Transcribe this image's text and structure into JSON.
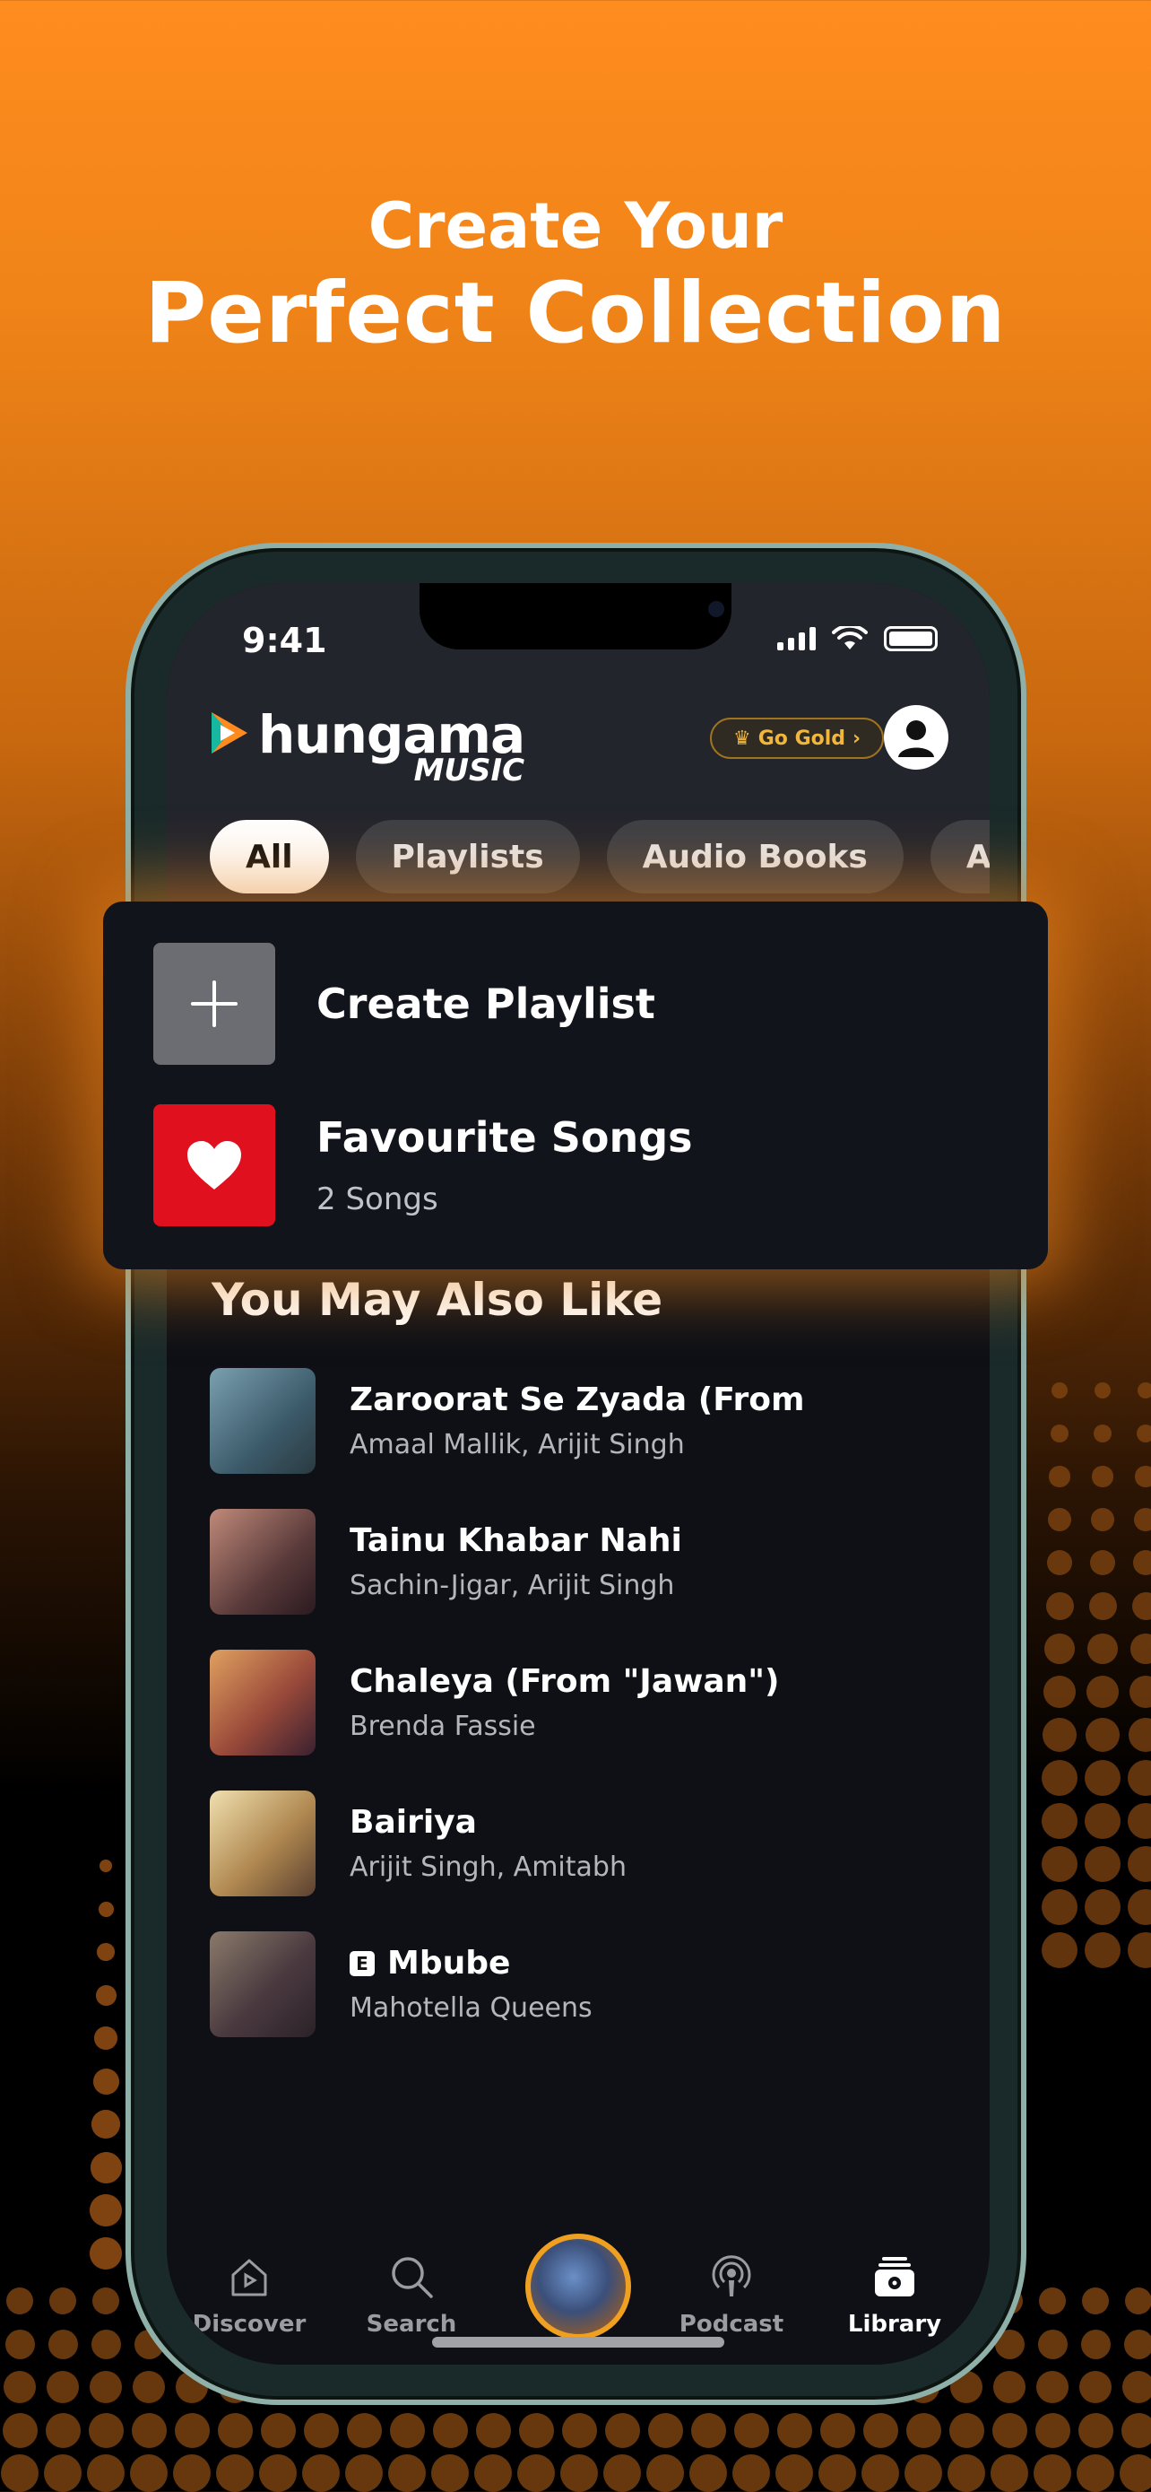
{
  "headline": {
    "line1": "Create Your",
    "line2": "Perfect Collection"
  },
  "status_bar": {
    "time": "9:41"
  },
  "header": {
    "logo_word": "hungama",
    "logo_sub": "MUSIC",
    "go_gold_label": "Go Gold"
  },
  "tabs": [
    "All",
    "Playlists",
    "Audio Books",
    "Aud"
  ],
  "card": {
    "create_playlist": "Create Playlist",
    "favourite_title": "Favourite Songs",
    "favourite_count": "2 Songs"
  },
  "section_title": "You May Also Like",
  "songs": [
    {
      "title": "Zaroorat Se Zyada (From",
      "artists": "Amaal Mallik,  Arijit Singh",
      "explicit": false
    },
    {
      "title": "Tainu Khabar Nahi",
      "artists": "Sachin-Jigar,  Arijit Singh",
      "explicit": false
    },
    {
      "title": "Chaleya (From \"Jawan\")",
      "artists": "Brenda Fassie",
      "explicit": false
    },
    {
      "title": "Bairiya",
      "artists": "Arijit Singh, Amitabh",
      "explicit": false
    },
    {
      "title": "Mbube",
      "artists": "Mahotella Queens",
      "explicit": true,
      "explicit_label": "E"
    }
  ],
  "bottom_nav": {
    "discover": "Discover",
    "search": "Search",
    "podcast": "Podcast",
    "library": "Library"
  },
  "colors": {
    "accent_orange": "#f28a1e",
    "gold": "#f2b63a",
    "favourite_red": "#e0101e"
  }
}
